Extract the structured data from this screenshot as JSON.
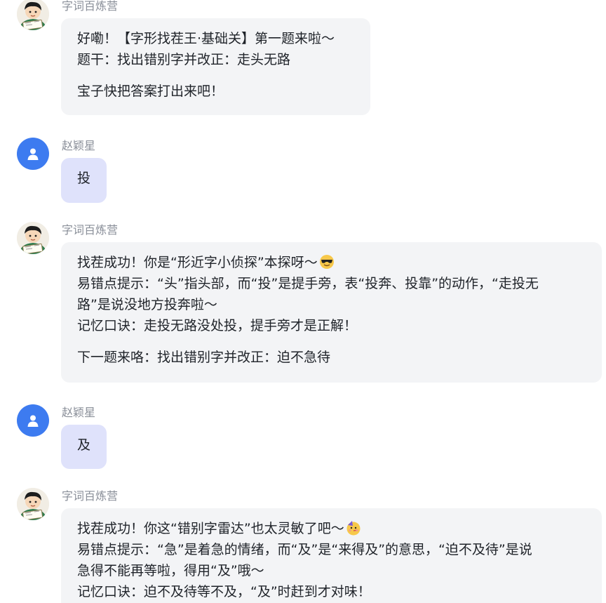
{
  "messages": [
    {
      "sender": "bot",
      "name": "字词百炼营",
      "lines": [
        "好嘞！【字形找茬王·基础关】第一题来啦～",
        "题干：找出错别字并改正：走头无路",
        "宝子快把答案打出来吧！"
      ]
    },
    {
      "sender": "user",
      "name": "赵颖星",
      "text": "投"
    },
    {
      "sender": "bot",
      "name": "字词百炼营",
      "lines": [
        "找茬成功！你是“形近字小侦探”本探呀～",
        "易错点提示：“头”指头部，而“投”是提手旁，表“投奔、投靠”的动作，“走投无",
        "路”是说没地方投奔啦～",
        "记忆口诀：走投无路没处投，提手旁才是正解！",
        "下一题来咯：找出错别字并改正：迫不急待"
      ],
      "emoji": "smiling-face-with-sunglasses-icon"
    },
    {
      "sender": "user",
      "name": "赵颖星",
      "text": "及"
    },
    {
      "sender": "bot",
      "name": "字词百炼营",
      "lines": [
        "找茬成功！你这“错别字雷达”也太灵敏了吧～",
        "易错点提示：“急”是着急的情绪，而“及”是“来得及”的意思，“迫不及待”是说",
        "急得不能再等啦，得用“及”哦～",
        "记忆口诀：迫不及待等不及，“及”时赶到才对味！"
      ],
      "emoji": "partying-face-icon"
    }
  ],
  "colors": {
    "user_avatar": "#3d7bf0",
    "user_bubble": "#dfe2fb",
    "bot_bubble": "#f3f4f6",
    "name_text": "#8a8f99"
  }
}
